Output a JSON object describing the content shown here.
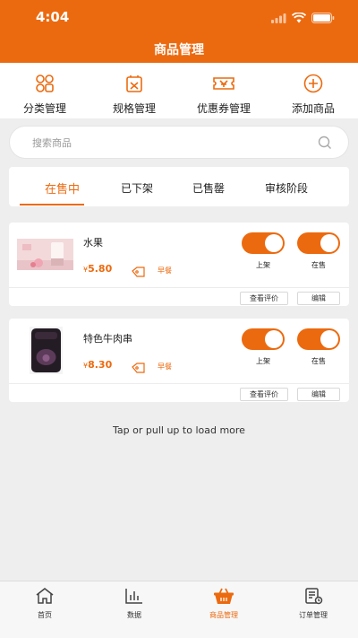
{
  "status_bar": {
    "time": "4:04"
  },
  "header": {
    "title": "商品管理"
  },
  "quick_actions": [
    {
      "label": "分类管理",
      "icon": "category-icon"
    },
    {
      "label": "规格管理",
      "icon": "spec-icon"
    },
    {
      "label": "优惠券管理",
      "icon": "coupon-icon"
    },
    {
      "label": "添加商品",
      "icon": "add-circle-icon"
    }
  ],
  "search": {
    "placeholder": "搜索商品"
  },
  "tabs": [
    {
      "label": "在售中",
      "active": true
    },
    {
      "label": "已下架",
      "active": false
    },
    {
      "label": "已售罄",
      "active": false
    },
    {
      "label": "审核阶段",
      "active": false
    }
  ],
  "products": [
    {
      "name": "水果",
      "currency": "¥",
      "price": "5.80",
      "category": "早餐",
      "toggle1_label": "上架",
      "toggle2_label": "在售",
      "toggle1_on": true,
      "toggle2_on": true,
      "reviews_button": "查看评价",
      "edit_button": "编辑"
    },
    {
      "name": "特色牛肉串",
      "currency": "¥",
      "price": "8.30",
      "category": "早餐",
      "toggle1_label": "上架",
      "toggle2_label": "在售",
      "toggle1_on": true,
      "toggle2_on": true,
      "reviews_button": "查看评价",
      "edit_button": "编辑"
    }
  ],
  "load_more": "Tap or pull up to load more",
  "tab_bar": [
    {
      "label": "首页",
      "icon": "home-icon",
      "active": false
    },
    {
      "label": "数据",
      "icon": "chart-icon",
      "active": false
    },
    {
      "label": "商品管理",
      "icon": "basket-icon",
      "active": true
    },
    {
      "label": "订单管理",
      "icon": "order-icon",
      "active": false
    }
  ],
  "colors": {
    "accent": "#ec6a0f",
    "background": "#eeeeee"
  }
}
